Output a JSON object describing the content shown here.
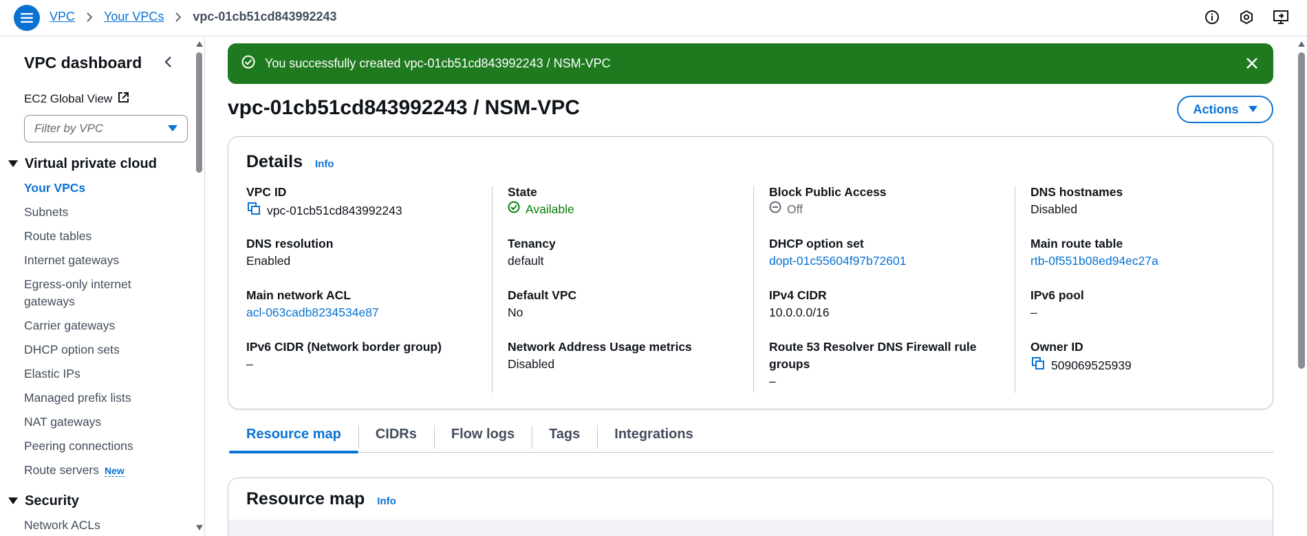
{
  "breadcrumb": {
    "items": [
      "VPC",
      "Your VPCs"
    ],
    "current": "vpc-01cb51cd843992243"
  },
  "top_icons": [
    "info-circle-icon",
    "settings-hexagon-icon",
    "screen-share-icon"
  ],
  "sidebar": {
    "title": "VPC dashboard",
    "global_view": "EC2 Global View",
    "filter_placeholder": "Filter by VPC",
    "sections": [
      {
        "label": "Virtual private cloud",
        "items": [
          {
            "label": "Your VPCs",
            "active": true
          },
          {
            "label": "Subnets"
          },
          {
            "label": "Route tables"
          },
          {
            "label": "Internet gateways"
          },
          {
            "label": "Egress-only internet gateways"
          },
          {
            "label": "Carrier gateways"
          },
          {
            "label": "DHCP option sets"
          },
          {
            "label": "Elastic IPs"
          },
          {
            "label": "Managed prefix lists"
          },
          {
            "label": "NAT gateways"
          },
          {
            "label": "Peering connections"
          },
          {
            "label": "Route servers",
            "badge": "New"
          }
        ]
      },
      {
        "label": "Security",
        "items": [
          {
            "label": "Network ACLs"
          }
        ]
      }
    ]
  },
  "flash": {
    "message": "You successfully created vpc-01cb51cd843992243 / NSM-VPC",
    "color": "#1f7a1f"
  },
  "page": {
    "title": "vpc-01cb51cd843992243 / NSM-VPC",
    "actions_label": "Actions"
  },
  "details": {
    "heading": "Details",
    "info": "Info",
    "columns": [
      [
        {
          "key": "VPC ID",
          "value": "vpc-01cb51cd843992243"
        },
        {
          "key": "DNS resolution",
          "value": "Enabled"
        },
        {
          "key": "Main network ACL",
          "value": "acl-063cadb8234534e87"
        },
        {
          "key": "IPv6 CIDR (Network border group)",
          "value": "–"
        }
      ],
      [
        {
          "key": "State",
          "value": "Available"
        },
        {
          "key": "Tenancy",
          "value": "default"
        },
        {
          "key": "Default VPC",
          "value": "No"
        },
        {
          "key": "Network Address Usage metrics",
          "value": "Disabled"
        }
      ],
      [
        {
          "key": "Block Public Access",
          "value": "Off"
        },
        {
          "key": "DHCP option set",
          "value": "dopt-01c55604f97b72601"
        },
        {
          "key": "IPv4 CIDR",
          "value": "10.0.0.0/16"
        },
        {
          "key": "Route 53 Resolver DNS Firewall rule groups",
          "value": "–"
        }
      ],
      [
        {
          "key": "DNS hostnames",
          "value": "Disabled"
        },
        {
          "key": "Main route table",
          "value": "rtb-0f551b08ed94ec27a"
        },
        {
          "key": "IPv6 pool",
          "value": "–"
        },
        {
          "key": "Owner ID",
          "value": "509069525939"
        }
      ]
    ]
  },
  "tabs": [
    "Resource map",
    "CIDRs",
    "Flow logs",
    "Tags",
    "Integrations"
  ],
  "resource_map": {
    "heading": "Resource map",
    "info": "Info"
  },
  "colors": {
    "accent": "#0972d3",
    "success": "#037f0c"
  }
}
